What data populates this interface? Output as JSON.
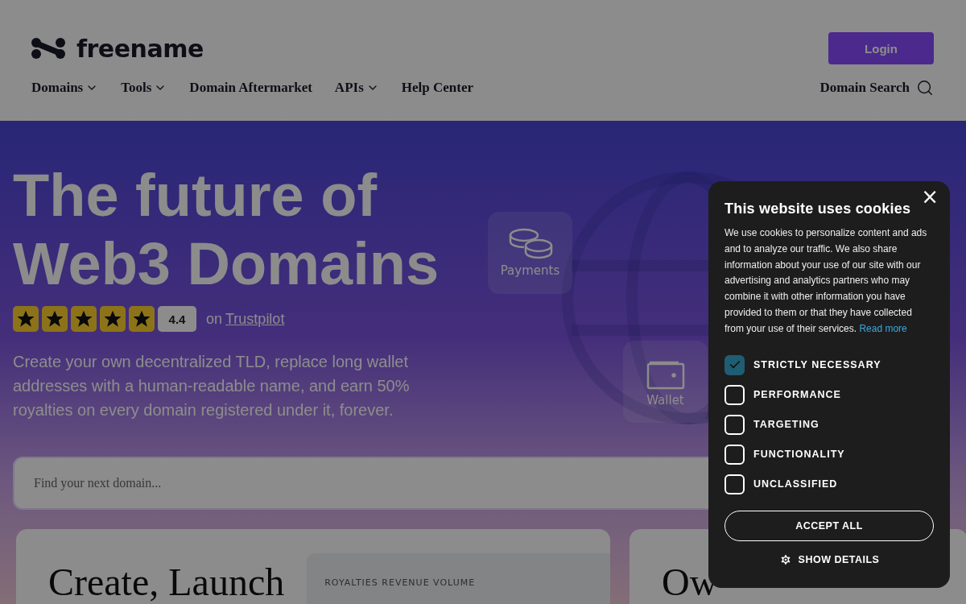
{
  "logo": {
    "text": "freename"
  },
  "login_button": "Login",
  "nav": [
    {
      "label": "Domains",
      "dropdown": true
    },
    {
      "label": "Tools",
      "dropdown": true
    },
    {
      "label": "Domain Aftermarket",
      "dropdown": false
    },
    {
      "label": "APIs",
      "dropdown": true
    },
    {
      "label": "Help Center",
      "dropdown": false
    }
  ],
  "domain_search": "Domain Search",
  "hero": {
    "title_lines": [
      "The future of",
      "Web3 Domains"
    ],
    "rating": {
      "stars": 5,
      "score": "4.4",
      "prefix": "on",
      "link": "Trustpilot"
    },
    "description": "Create your own decentralized TLD, replace long wallet addresses with a human-readable name, and earn 50% royalties on every domain registered under it, forever.",
    "tiles": [
      {
        "label": "Payments",
        "kind": "coins"
      },
      {
        "label": "Wallet",
        "kind": "wallet"
      }
    ],
    "search": {
      "placeholder": "Find your next domain..."
    }
  },
  "cards": [
    {
      "heading": "Create, Launch",
      "panel_label": "ROYALTIES REVENUE VOLUME"
    },
    {
      "heading": "Ow"
    }
  ],
  "cookie_dialog": {
    "close": "×",
    "title": "This website uses cookies",
    "text": "We use cookies to personalize content and ads and to analyze our traffic. We also share information about your use of our site with our advertising and analytics partners who may combine it with other information you have provided to them or that they have collected from your use of their services.",
    "link": "Read more",
    "options": [
      {
        "label": "STRICTLY NECESSARY",
        "checked": true
      },
      {
        "label": "PERFORMANCE",
        "checked": false
      },
      {
        "label": "TARGETING",
        "checked": false
      },
      {
        "label": "FUNCTIONALITY",
        "checked": false
      },
      {
        "label": "UNCLASSIFIED",
        "checked": false
      }
    ],
    "accept_all": "ACCEPT ALL",
    "show_details": "SHOW DETAILS"
  }
}
